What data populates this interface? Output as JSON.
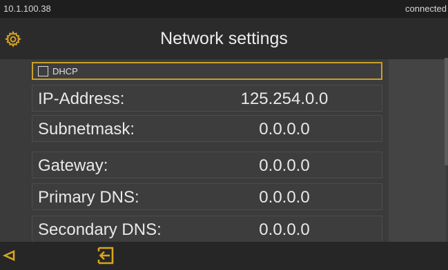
{
  "status": {
    "ip_address": "10.1.100.38",
    "connection": "connected"
  },
  "header": {
    "title": "Network settings",
    "icon": "gear-icon"
  },
  "dhcp": {
    "label": "DHCP",
    "checked": false
  },
  "fields": [
    {
      "label": "IP-Address:",
      "value": "125.254.0.0"
    },
    {
      "label": "Subnetmask:",
      "value": "0.0.0.0"
    },
    {
      "label": "Gateway:",
      "value": "0.0.0.0"
    },
    {
      "label": "Primary DNS:",
      "value": "0.0.0.0"
    },
    {
      "label": "Secondary DNS:",
      "value": "0.0.0.0"
    }
  ],
  "footer": {
    "back_icon": "back-triangle-icon",
    "exit_icon": "exit-icon"
  },
  "colors": {
    "accent": "#c9a227",
    "background": "#3b3b3b",
    "bar": "#262626"
  }
}
